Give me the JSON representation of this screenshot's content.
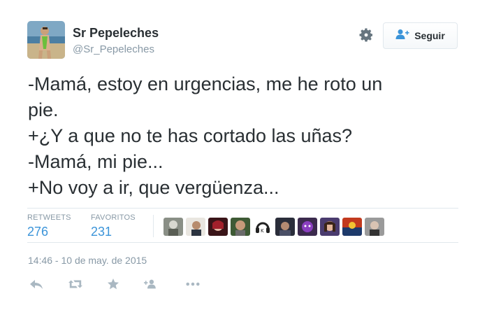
{
  "user": {
    "name": "Sr Pepeleches",
    "handle": "@Sr_Pepeleches"
  },
  "follow_button": {
    "label": "Seguir",
    "icon": "follow-person-plus-icon"
  },
  "settings_icon": "gear-icon",
  "tweet": {
    "lines": [
      "-Mamá, estoy en urgencias, me he roto un",
      "pie.",
      "+¿Y a que no te has cortado las uñas?",
      "-Mamá, mi pie...",
      "+No voy a ir, que vergüenza..."
    ]
  },
  "stats": {
    "retweets_label": "RETWEETS",
    "retweets_count": "276",
    "favorites_label": "FAVORITOS",
    "favorites_count": "231"
  },
  "timestamp": "14:46 - 10 de may. de 2015",
  "actions": [
    "reply-icon",
    "retweet-icon",
    "favorite-star-icon",
    "follow-icon",
    "more-dots-icon"
  ],
  "colors": {
    "text": "#292f33",
    "muted": "#8899a6",
    "link": "#3b94d9",
    "border": "#e1e8ed"
  }
}
